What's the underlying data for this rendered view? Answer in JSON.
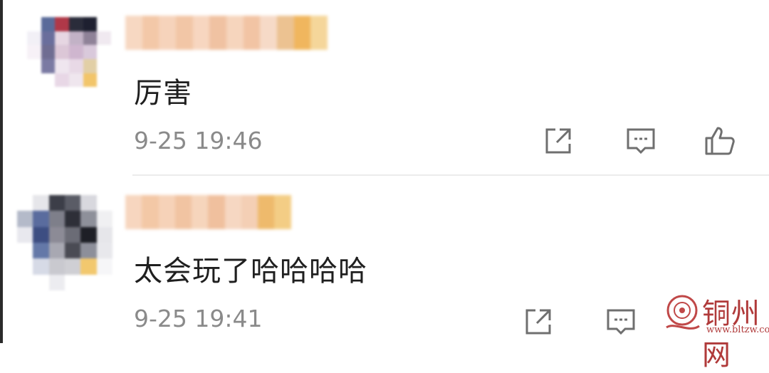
{
  "comments": [
    {
      "text": "厉害",
      "time": "9-25 19:46"
    },
    {
      "text": "太会玩了哈哈哈哈",
      "time": "9-25 19:41"
    }
  ],
  "actions": [
    "share-icon",
    "comment-icon",
    "like-icon"
  ],
  "colors": {
    "text": "#1f1f1f",
    "meta": "#8a8a8a",
    "icon": "#6f6f6f",
    "divider": "#ececec",
    "watermark": "#b03a3a"
  },
  "watermark": {
    "title": "铜州网",
    "url": "www.bltzw.com"
  }
}
